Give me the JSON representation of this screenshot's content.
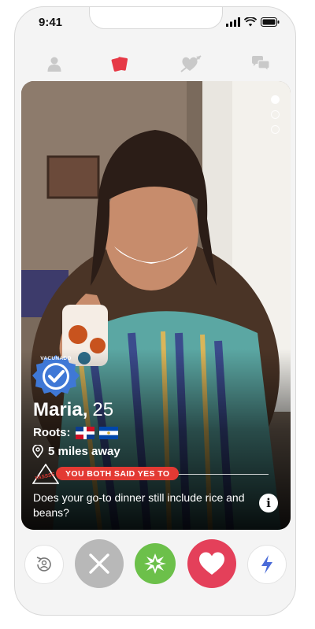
{
  "status_bar": {
    "time": "9:41"
  },
  "nav": {
    "items": [
      {
        "icon": "profile-icon",
        "active": false
      },
      {
        "icon": "cards-icon",
        "active": true
      },
      {
        "icon": "heart-arrow-icon",
        "active": false
      },
      {
        "icon": "chat-icon",
        "active": false
      }
    ]
  },
  "profile": {
    "badge_text": "VACUNADO",
    "name": "Maria",
    "age": "25",
    "roots_label": "Roots:",
    "flags": [
      "dominican-republic-flag",
      "el-salvador-flag"
    ],
    "distance": "5 miles away",
    "stamp_text": "YASSSS",
    "both_said_yes": "YOU BOTH SAID YES TO",
    "question": "Does your go-to dinner still include rice and beans?",
    "photo_count": 3,
    "active_photo": 1
  },
  "actions": [
    {
      "name": "rewind",
      "icon": "rewind-icon"
    },
    {
      "name": "pass",
      "icon": "close-icon"
    },
    {
      "name": "super",
      "icon": "star-burst-icon"
    },
    {
      "name": "like",
      "icon": "heart-icon"
    },
    {
      "name": "boost",
      "icon": "lightning-icon"
    }
  ],
  "colors": {
    "accent_red": "#e63946",
    "pass_gray": "#b8b8b8",
    "super_green": "#6cc04a",
    "like_red": "#e4405a",
    "boost_blue": "#4a6bd8",
    "badge_blue": "#3f78d6"
  }
}
